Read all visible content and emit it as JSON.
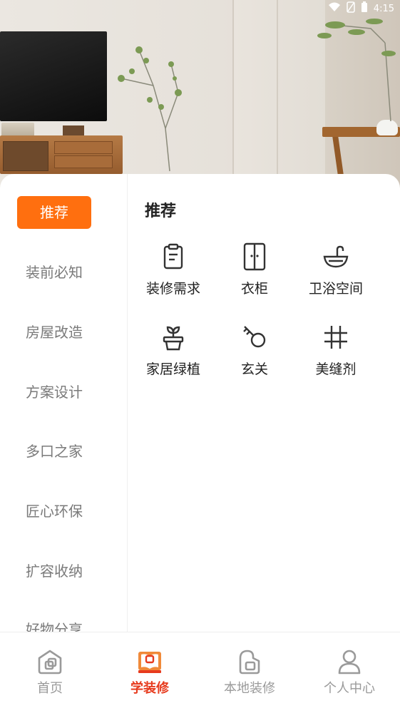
{
  "status_bar": {
    "time": "4:15"
  },
  "section": {
    "title": "推荐"
  },
  "sidebar": {
    "items": [
      {
        "label": "推荐",
        "active": true
      },
      {
        "label": "装前必知"
      },
      {
        "label": "房屋改造"
      },
      {
        "label": "方案设计"
      },
      {
        "label": "多口之家"
      },
      {
        "label": "匠心环保"
      },
      {
        "label": "扩容收纳"
      },
      {
        "label": "好物分享"
      }
    ]
  },
  "grid": {
    "items": [
      {
        "label": "装修需求",
        "icon": "clipboard-icon"
      },
      {
        "label": "衣柜",
        "icon": "wardrobe-icon"
      },
      {
        "label": "卫浴空间",
        "icon": "washbasin-icon"
      },
      {
        "label": "家居绿植",
        "icon": "potted-plant-icon"
      },
      {
        "label": "玄关",
        "icon": "key-icon"
      },
      {
        "label": "美缝剂",
        "icon": "grid-hash-icon"
      }
    ]
  },
  "bottom_nav": {
    "items": [
      {
        "label": "首页",
        "icon": "home-icon"
      },
      {
        "label": "学装修",
        "icon": "book-icon",
        "active": true
      },
      {
        "label": "本地装修",
        "icon": "local-house-icon"
      },
      {
        "label": "个人中心",
        "icon": "person-icon"
      }
    ]
  },
  "colors": {
    "accent": "#ff6f0f",
    "nav_active": "#e73b1e",
    "nav_inactive": "#9a9a9a"
  }
}
